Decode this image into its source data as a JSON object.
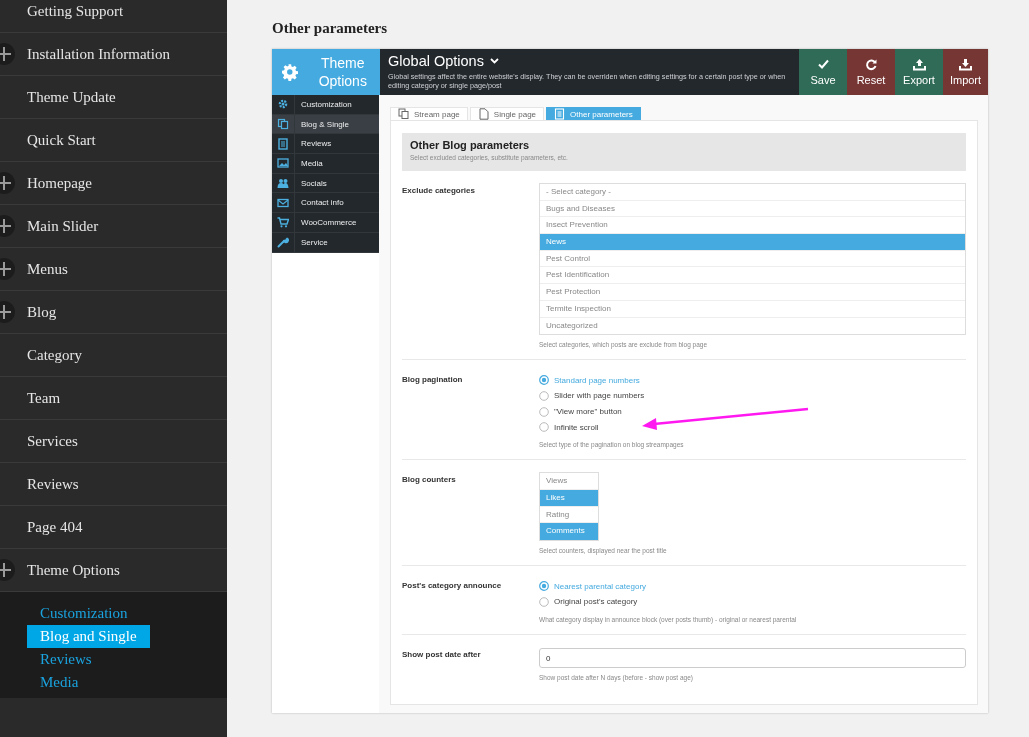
{
  "sidebar": {
    "items": [
      {
        "label": "Getting Support",
        "expandable": false
      },
      {
        "label": "Installation Information",
        "expandable": true
      },
      {
        "label": "Theme Update",
        "expandable": false
      },
      {
        "label": "Quick Start",
        "expandable": false
      },
      {
        "label": "Homepage",
        "expandable": true
      },
      {
        "label": "Main Slider",
        "expandable": true
      },
      {
        "label": "Menus",
        "expandable": true
      },
      {
        "label": "Blog",
        "expandable": true
      },
      {
        "label": "Category",
        "expandable": false
      },
      {
        "label": "Team",
        "expandable": false
      },
      {
        "label": "Services",
        "expandable": false
      },
      {
        "label": "Reviews",
        "expandable": false
      },
      {
        "label": "Page 404",
        "expandable": false
      },
      {
        "label": "Theme Options",
        "expandable": true,
        "children": [
          {
            "label": "Customization",
            "selected": false
          },
          {
            "label": "Blog and Single",
            "selected": true
          },
          {
            "label": "Reviews",
            "selected": false
          },
          {
            "label": "Media",
            "selected": false
          }
        ]
      }
    ]
  },
  "page_title": "Other parameters",
  "panel": {
    "brand": "Theme Options",
    "header": {
      "title": "Global Options",
      "description": "Global settings affect the entire website's display. They can be overriden when editing settings for a certain post type or when editing category or single page/post"
    },
    "actions": [
      {
        "label": "Save",
        "kind": "save"
      },
      {
        "label": "Reset",
        "kind": "reset"
      },
      {
        "label": "Export",
        "kind": "export"
      },
      {
        "label": "Import",
        "kind": "import"
      }
    ],
    "menu": [
      {
        "label": "Customization",
        "selected": false
      },
      {
        "label": "Blog & Single",
        "selected": true
      },
      {
        "label": "Reviews",
        "selected": false
      },
      {
        "label": "Media",
        "selected": false
      },
      {
        "label": "Socials",
        "selected": false
      },
      {
        "label": "Contact info",
        "selected": false
      },
      {
        "label": "WooCommerce",
        "selected": false
      },
      {
        "label": "Service",
        "selected": false
      }
    ],
    "tabs": [
      {
        "label": "Stream page",
        "selected": false
      },
      {
        "label": "Single page",
        "selected": false
      },
      {
        "label": "Other parameters",
        "selected": true
      }
    ],
    "section": {
      "title": "Other Blog parameters",
      "subtitle": "Select excluded categories, substitute parameters, etc."
    },
    "fields": [
      {
        "kind": "list",
        "label": "Exclude categories",
        "wide": true,
        "options": [
          {
            "label": "- Select category -",
            "selected": false
          },
          {
            "label": "Bugs and Diseases",
            "selected": false
          },
          {
            "label": "Insect Prevention",
            "selected": false
          },
          {
            "label": "News",
            "selected": true
          },
          {
            "label": "Pest Control",
            "selected": false
          },
          {
            "label": "Pest Identification",
            "selected": false
          },
          {
            "label": "Pest Protection",
            "selected": false
          },
          {
            "label": "Termite Inspection",
            "selected": false
          },
          {
            "label": "Uncategorized",
            "selected": false
          }
        ],
        "hint": "Select categories, which posts are exclude from blog page"
      },
      {
        "kind": "radio",
        "label": "Blog pagination",
        "options": [
          {
            "label": "Standard page numbers",
            "selected": true
          },
          {
            "label": "Slider with page numbers",
            "selected": false
          },
          {
            "label": "\"View more\" button",
            "selected": false
          },
          {
            "label": "Infinite scroll",
            "selected": false
          }
        ],
        "hint": "Select type of the pagination on blog streampages"
      },
      {
        "kind": "list",
        "label": "Blog counters",
        "wide": false,
        "options": [
          {
            "label": "Views",
            "selected": false
          },
          {
            "label": "Likes",
            "selected": true
          },
          {
            "label": "Rating",
            "selected": false
          },
          {
            "label": "Comments",
            "selected": true
          }
        ],
        "hint": "Select counters, displayed near the post title"
      },
      {
        "kind": "radio",
        "label": "Post's category announce",
        "options": [
          {
            "label": "Nearest parental category",
            "selected": true
          },
          {
            "label": "Original post's category",
            "selected": false
          }
        ],
        "hint": "What category display in announce block (over posts thumb) - original or nearest parental"
      },
      {
        "kind": "text",
        "label": "Show post date after",
        "value": "0",
        "hint": "Show post date after N days (before - show post age)"
      }
    ]
  }
}
